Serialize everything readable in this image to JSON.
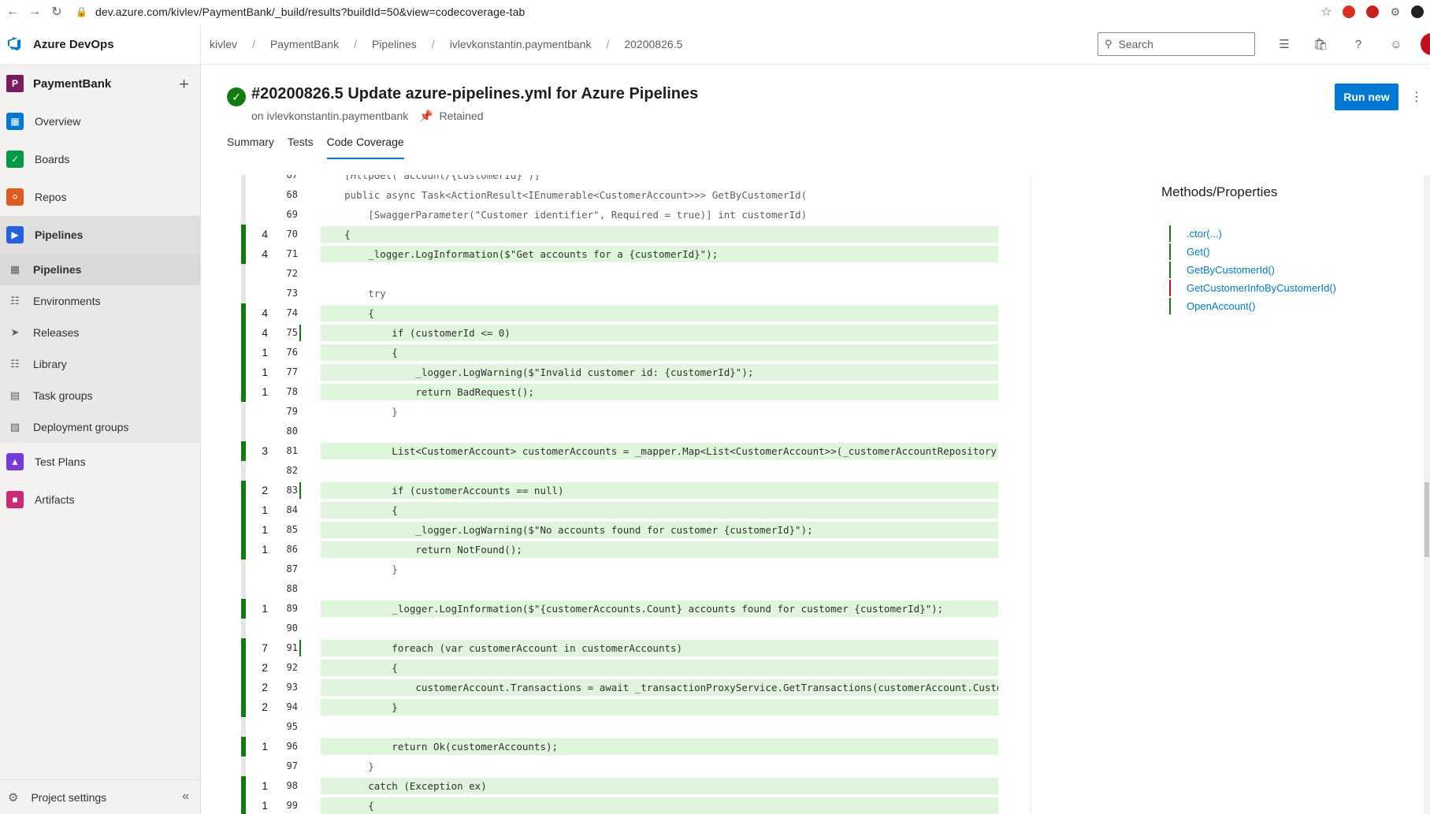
{
  "browser": {
    "url": "dev.azure.com/kivlev/PaymentBank/_build/results?buildId=50&view=codecoverage-tab"
  },
  "header": {
    "logo_text": "Azure DevOps",
    "breadcrumb": [
      "kivlev",
      "PaymentBank",
      "Pipelines",
      "ivlevkonstantin.paymentbank",
      "20200826.5"
    ],
    "search_placeholder": "Search"
  },
  "sidebar": {
    "project_initial": "P",
    "project_name": "PaymentBank",
    "items": [
      {
        "label": "Overview",
        "icon": "overview-icon",
        "color": "#0078d4"
      },
      {
        "label": "Boards",
        "icon": "boards-icon",
        "color": "#009a44"
      },
      {
        "label": "Repos",
        "icon": "repos-icon",
        "color": "#e05b1f"
      },
      {
        "label": "Pipelines",
        "icon": "pipelines-icon",
        "color": "#2560e0"
      }
    ],
    "pipelines_sub": [
      {
        "label": "Pipelines",
        "icon": "pipelines-sub-icon"
      },
      {
        "label": "Environments",
        "icon": "environments-icon"
      },
      {
        "label": "Releases",
        "icon": "releases-icon"
      },
      {
        "label": "Library",
        "icon": "library-icon"
      },
      {
        "label": "Task groups",
        "icon": "task-groups-icon"
      },
      {
        "label": "Deployment groups",
        "icon": "deployment-groups-icon"
      }
    ],
    "bottom_items": [
      {
        "label": "Test Plans",
        "icon": "test-plans-icon",
        "color": "#773adc"
      },
      {
        "label": "Artifacts",
        "icon": "artifacts-icon",
        "color": "#cc2975"
      }
    ],
    "settings_label": "Project settings"
  },
  "run": {
    "title": "#20200826.5 Update azure-pipelines.yml for Azure Pipelines",
    "on_label": "on ivlevkonstantin.paymentbank",
    "retained_label": "Retained",
    "run_new_label": "Run new",
    "tabs": [
      "Summary",
      "Tests",
      "Code Coverage"
    ]
  },
  "methods": {
    "title": "Methods/Properties",
    "items": [
      {
        "label": ".ctor(...)",
        "status": "covered"
      },
      {
        "label": "Get()",
        "status": "covered"
      },
      {
        "label": "GetByCustomerId()",
        "status": "covered"
      },
      {
        "label": "GetCustomerInfoByCustomerId()",
        "status": "partial"
      },
      {
        "label": "OpenAccount()",
        "status": "covered"
      }
    ]
  },
  "code_lines": [
    {
      "n": "67",
      "hits": "",
      "code": "    [HttpGet(\"account/{customerId}\")]",
      "covered": false,
      "branch": false
    },
    {
      "n": "68",
      "hits": "",
      "code": "    public async Task<ActionResult<IEnumerable<CustomerAccount>>> GetByCustomerId(",
      "covered": false,
      "branch": false
    },
    {
      "n": "69",
      "hits": "",
      "code": "        [SwaggerParameter(\"Customer identifier\", Required = true)] int customerId)",
      "covered": false,
      "branch": false
    },
    {
      "n": "70",
      "hits": "4",
      "code": "    {",
      "covered": true,
      "branch": false
    },
    {
      "n": "71",
      "hits": "4",
      "code": "        _logger.LogInformation($\"Get accounts for a {customerId}\");",
      "covered": true,
      "branch": false
    },
    {
      "n": "72",
      "hits": "",
      "code": "",
      "covered": false,
      "branch": false
    },
    {
      "n": "73",
      "hits": "",
      "code": "        try",
      "covered": false,
      "branch": false
    },
    {
      "n": "74",
      "hits": "4",
      "code": "        {",
      "covered": true,
      "branch": false
    },
    {
      "n": "75",
      "hits": "4",
      "code": "            if (customerId <= 0)",
      "covered": true,
      "branch": true
    },
    {
      "n": "76",
      "hits": "1",
      "code": "            {",
      "covered": true,
      "branch": false
    },
    {
      "n": "77",
      "hits": "1",
      "code": "                _logger.LogWarning($\"Invalid customer id: {customerId}\");",
      "covered": true,
      "branch": false
    },
    {
      "n": "78",
      "hits": "1",
      "code": "                return BadRequest();",
      "covered": true,
      "branch": false
    },
    {
      "n": "79",
      "hits": "",
      "code": "            }",
      "covered": false,
      "branch": false
    },
    {
      "n": "80",
      "hits": "",
      "code": "",
      "covered": false,
      "branch": false
    },
    {
      "n": "81",
      "hits": "3",
      "code": "            List<CustomerAccount> customerAccounts = _mapper.Map<List<CustomerAccount>>(_customerAccountRepository.G",
      "covered": true,
      "branch": false
    },
    {
      "n": "82",
      "hits": "",
      "code": "",
      "covered": false,
      "branch": false
    },
    {
      "n": "83",
      "hits": "2",
      "code": "            if (customerAccounts == null)",
      "covered": true,
      "branch": true
    },
    {
      "n": "84",
      "hits": "1",
      "code": "            {",
      "covered": true,
      "branch": false
    },
    {
      "n": "85",
      "hits": "1",
      "code": "                _logger.LogWarning($\"No accounts found for customer {customerId}\");",
      "covered": true,
      "branch": false
    },
    {
      "n": "86",
      "hits": "1",
      "code": "                return NotFound();",
      "covered": true,
      "branch": false
    },
    {
      "n": "87",
      "hits": "",
      "code": "            }",
      "covered": false,
      "branch": false
    },
    {
      "n": "88",
      "hits": "",
      "code": "",
      "covered": false,
      "branch": false
    },
    {
      "n": "89",
      "hits": "1",
      "code": "            _logger.LogInformation($\"{customerAccounts.Count} accounts found for customer {customerId}\");",
      "covered": true,
      "branch": false
    },
    {
      "n": "90",
      "hits": "",
      "code": "",
      "covered": false,
      "branch": false
    },
    {
      "n": "91",
      "hits": "7",
      "code": "            foreach (var customerAccount in customerAccounts)",
      "covered": true,
      "branch": true
    },
    {
      "n": "92",
      "hits": "2",
      "code": "            {",
      "covered": true,
      "branch": false
    },
    {
      "n": "93",
      "hits": "2",
      "code": "                customerAccount.Transactions = await _transactionProxyService.GetTransactions(customerAccount.Custom",
      "covered": true,
      "branch": false
    },
    {
      "n": "94",
      "hits": "2",
      "code": "            }",
      "covered": true,
      "branch": false
    },
    {
      "n": "95",
      "hits": "",
      "code": "",
      "covered": false,
      "branch": false
    },
    {
      "n": "96",
      "hits": "1",
      "code": "            return Ok(customerAccounts);",
      "covered": true,
      "branch": false
    },
    {
      "n": "97",
      "hits": "",
      "code": "        }",
      "covered": false,
      "branch": false
    },
    {
      "n": "98",
      "hits": "1",
      "code": "        catch (Exception ex)",
      "covered": true,
      "branch": false
    },
    {
      "n": "99",
      "hits": "1",
      "code": "        {",
      "covered": true,
      "branch": false
    }
  ],
  "colors": {
    "covered_bar": "#107c10",
    "covered_bg": "#dff6dd",
    "partial_bar": "#c50f1f",
    "accent": "#0078d4"
  }
}
